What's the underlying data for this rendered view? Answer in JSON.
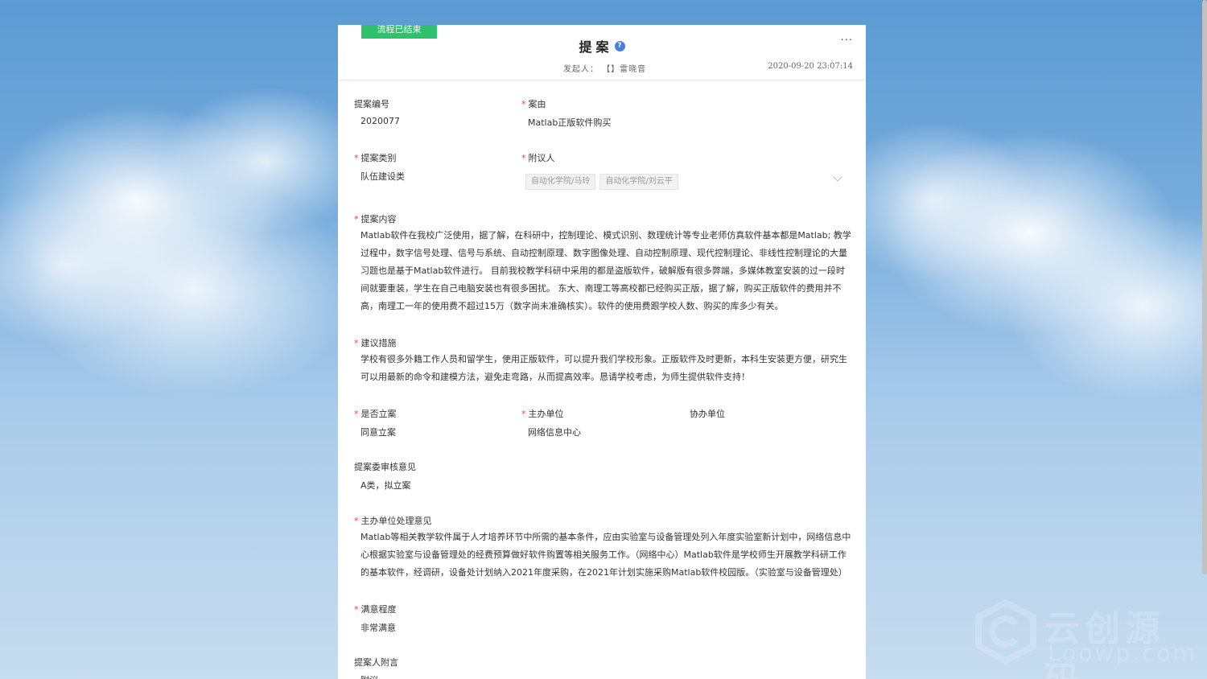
{
  "status": "流程已结束",
  "header": {
    "title": "提案",
    "help_symbol": "?",
    "more_symbol": "···",
    "initiator_label": "发起人：",
    "initiator_name": "【】雷晓音",
    "datetime": "2020-09-20 23:07:14"
  },
  "fields": {
    "proposal_no": {
      "label": "提案编号",
      "value": "2020077"
    },
    "cause": {
      "label": "案由",
      "value": "Matlab正版软件购买"
    },
    "category": {
      "label": "提案类别",
      "value": "队伍建设类"
    },
    "cosigners": {
      "label": "附议人",
      "tags": [
        "自动化学院/马玲",
        "自动化学院/刘云平"
      ]
    },
    "content": {
      "label": "提案内容",
      "value": "Matlab软件在我校广泛使用，据了解，在科研中，控制理论、模式识别、数理统计等专业老师仿真软件基本都是Matlab; 教学过程中，数字信号处理、信号与系统、自动控制原理、数字图像处理、自动控制原理、现代控制理论、非线性控制理论的大量习题也是基于Matlab软件进行。 目前我校教学科研中采用的都是盗版软件，破解版有很多弊端，多媒体教室安装的过一段时间就要重装，学生在自己电脑安装也有很多困扰。 东大、南理工等高校都已经购买正版，据了解，购买正版软件的费用并不高，南理工一年的使用费不超过15万（数字尚未准确核实）。软件的使用费跟学校人数、购买的库多少有关。"
    },
    "measures": {
      "label": "建议措施",
      "value": "学校有很多外籍工作人员和留学生，使用正版软件，可以提升我们学校形象。正版软件及时更新，本科生安装更方便，研究生可以用最新的命令和建模方法，避免走弯路，从而提高效率。恳请学校考虑，为师生提供软件支持！"
    },
    "filed": {
      "label": "是否立案",
      "value": "同意立案"
    },
    "host_unit": {
      "label": "主办单位",
      "value": "网络信息中心"
    },
    "assist_unit": {
      "label": "协办单位",
      "value": ""
    },
    "committee_opinion": {
      "label": "提案委审核意见",
      "value": "A类，拟立案"
    },
    "host_opinion": {
      "label": "主办单位处理意见",
      "value": "Matlab等相关教学软件属于人才培养环节中所需的基本条件，应由实验室与设备管理处列入年度实验室新计划中，网络信息中心根据实验室与设备管理处的经费预算做好软件购置等相关服务工作。（网络中心）Matlab软件是学校师生开展教学科研工作的基本软件，经调研，设备处计划纳入2021年度采购，在2021年计划实施采购Matlab软件校园版。（实验室与设备管理处）"
    },
    "satisfaction": {
      "label": "满意程度",
      "value": "非常满意"
    },
    "postscript": {
      "label": "提案人附言",
      "value": "附议"
    }
  },
  "watermark": {
    "brand": "云创源码",
    "domain": "Loowp.com"
  }
}
